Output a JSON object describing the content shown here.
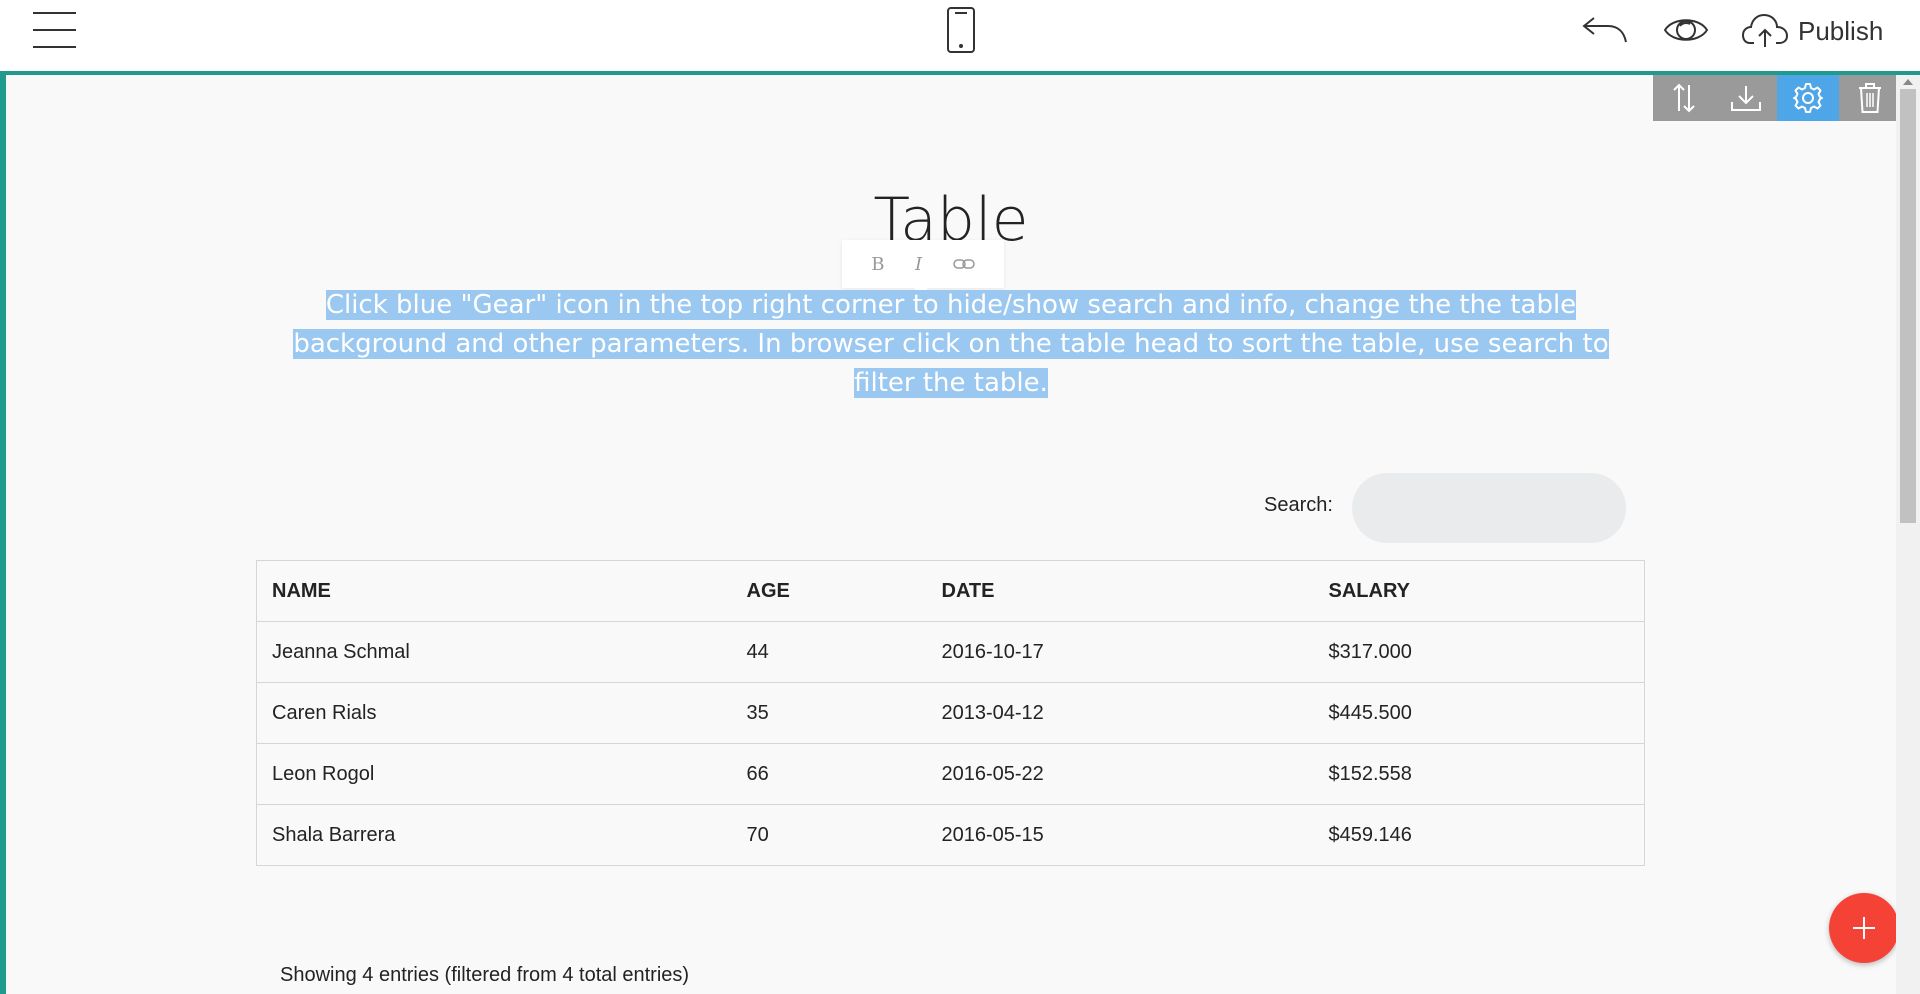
{
  "toolbar": {
    "menu_icon": "hamburger-menu-icon",
    "device_icon": "mobile-phone-icon",
    "undo_icon": "undo-icon",
    "preview_icon": "eye-icon",
    "publish_icon": "cloud-upload-icon",
    "publish_label": "Publish"
  },
  "block_tools": [
    {
      "icon": "sort-arrows-icon",
      "active": false
    },
    {
      "icon": "download-icon",
      "active": false
    },
    {
      "icon": "gear-icon",
      "active": true
    },
    {
      "icon": "trash-icon",
      "active": false
    }
  ],
  "section": {
    "title": "Table",
    "format_bar": {
      "bold": "B",
      "italic": "I",
      "link_icon": "link-icon"
    },
    "subtitle": "Click blue \"Gear\" icon in the top right corner to hide/show search and info, change the the table background and other parameters. In browser click on the table head to sort the table, use search to filter the table."
  },
  "search": {
    "label": "Search:",
    "value": "",
    "placeholder": ""
  },
  "table": {
    "headers": [
      "NAME",
      "AGE",
      "DATE",
      "SALARY"
    ],
    "rows": [
      [
        "Jeanna Schmal",
        "44",
        "2016-10-17",
        "$317.000"
      ],
      [
        "Caren Rials",
        "35",
        "2013-04-12",
        "$445.500"
      ],
      [
        "Leon Rogol",
        "66",
        "2016-05-22",
        "$152.558"
      ],
      [
        "Shala Barrera",
        "70",
        "2016-05-15",
        "$459.146"
      ]
    ]
  },
  "entries_info": "Showing 4 entries (filtered from 4 total entries)",
  "fab_icon": "plus-icon",
  "colors": {
    "accent_border": "#1f9a8c",
    "active_tool": "#4ea5e8",
    "selection_highlight": "#9ac8f0",
    "fab": "#f44336"
  }
}
